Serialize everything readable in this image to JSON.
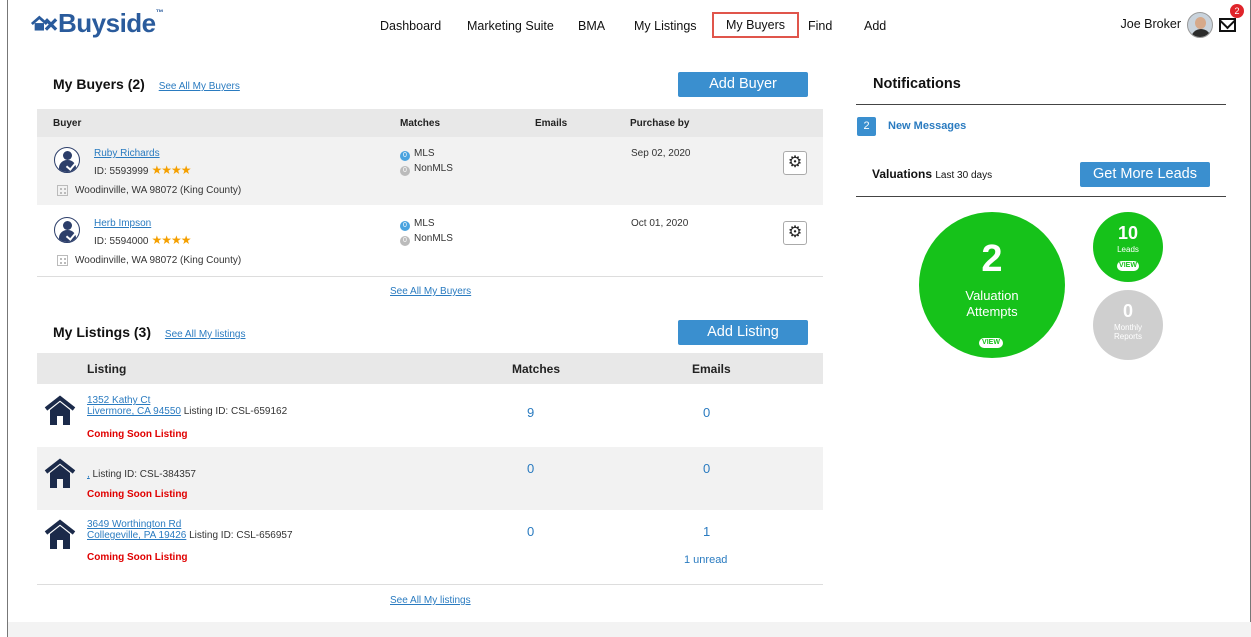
{
  "header": {
    "logo_text": "Buyside",
    "nav": [
      "Dashboard",
      "Marketing Suite",
      "BMA",
      "My Listings",
      "My Buyers",
      "Find",
      "Add"
    ],
    "active_nav": "My Buyers",
    "user_name": "Joe Broker",
    "mail_count": "2"
  },
  "buyers": {
    "title": "My Buyers (2)",
    "see_all": "See All My Buyers",
    "add_button": "Add Buyer",
    "columns": [
      "Buyer",
      "Matches",
      "Emails",
      "Purchase by"
    ],
    "rows": [
      {
        "name": "Ruby Richards",
        "id": "ID: 5593999",
        "stars": "★★★★",
        "location": "Woodinville, WA 98072 (King County)",
        "mls_count": "0",
        "mls": "MLS",
        "nonmls_count": "0",
        "nonmls": "NonMLS",
        "purchase_by": "Sep 02, 2020"
      },
      {
        "name": "Herb Impson",
        "id": "ID: 5594000",
        "stars": "★★★★",
        "location": "Woodinville, WA 98072 (King County)",
        "mls_count": "0",
        "mls": "MLS",
        "nonmls_count": "0",
        "nonmls": "NonMLS",
        "purchase_by": "Oct 01, 2020"
      }
    ],
    "footer_link": "See All My Buyers"
  },
  "listings": {
    "title": "My Listings (3)",
    "see_all": "See All My listings",
    "add_button": "Add Listing",
    "columns": [
      "Listing",
      "Matches",
      "Emails"
    ],
    "rows": [
      {
        "street": "1352 Kathy Ct",
        "city": "Livermore, CA 94550",
        "listing_id": " Listing ID: CSL-659162",
        "status": "Coming Soon Listing",
        "matches": "9",
        "emails": "0",
        "unread": ""
      },
      {
        "street": "",
        "city": ",",
        "listing_id": " Listing ID: CSL-384357",
        "status": "Coming Soon Listing",
        "matches": "0",
        "emails": "0",
        "unread": ""
      },
      {
        "street": "3649 Worthington Rd",
        "city": "Collegeville, PA 19426",
        "listing_id": " Listing ID: CSL-656957",
        "status": "Coming Soon Listing",
        "matches": "0",
        "emails": "1",
        "unread": "1 unread"
      }
    ],
    "footer_link": "See All My listings"
  },
  "notifications": {
    "title": "Notifications",
    "message_count": "2",
    "message_label": "New Messages"
  },
  "valuations": {
    "title": "Valuations",
    "subtitle": "Last 30 days",
    "cta": "Get More Leads",
    "attempts": "2",
    "attempts_label_1": "Valuation",
    "attempts_label_2": "Attempts",
    "leads": "10",
    "leads_label": "Leads",
    "reports": "0",
    "reports_label_1": "Monthly",
    "reports_label_2": "Reports",
    "view_label": "VIEW"
  },
  "colors": {
    "brand": "#2a5b9c",
    "accent": "#3a8fcf",
    "green": "#16c21a",
    "alert": "#e00000"
  }
}
